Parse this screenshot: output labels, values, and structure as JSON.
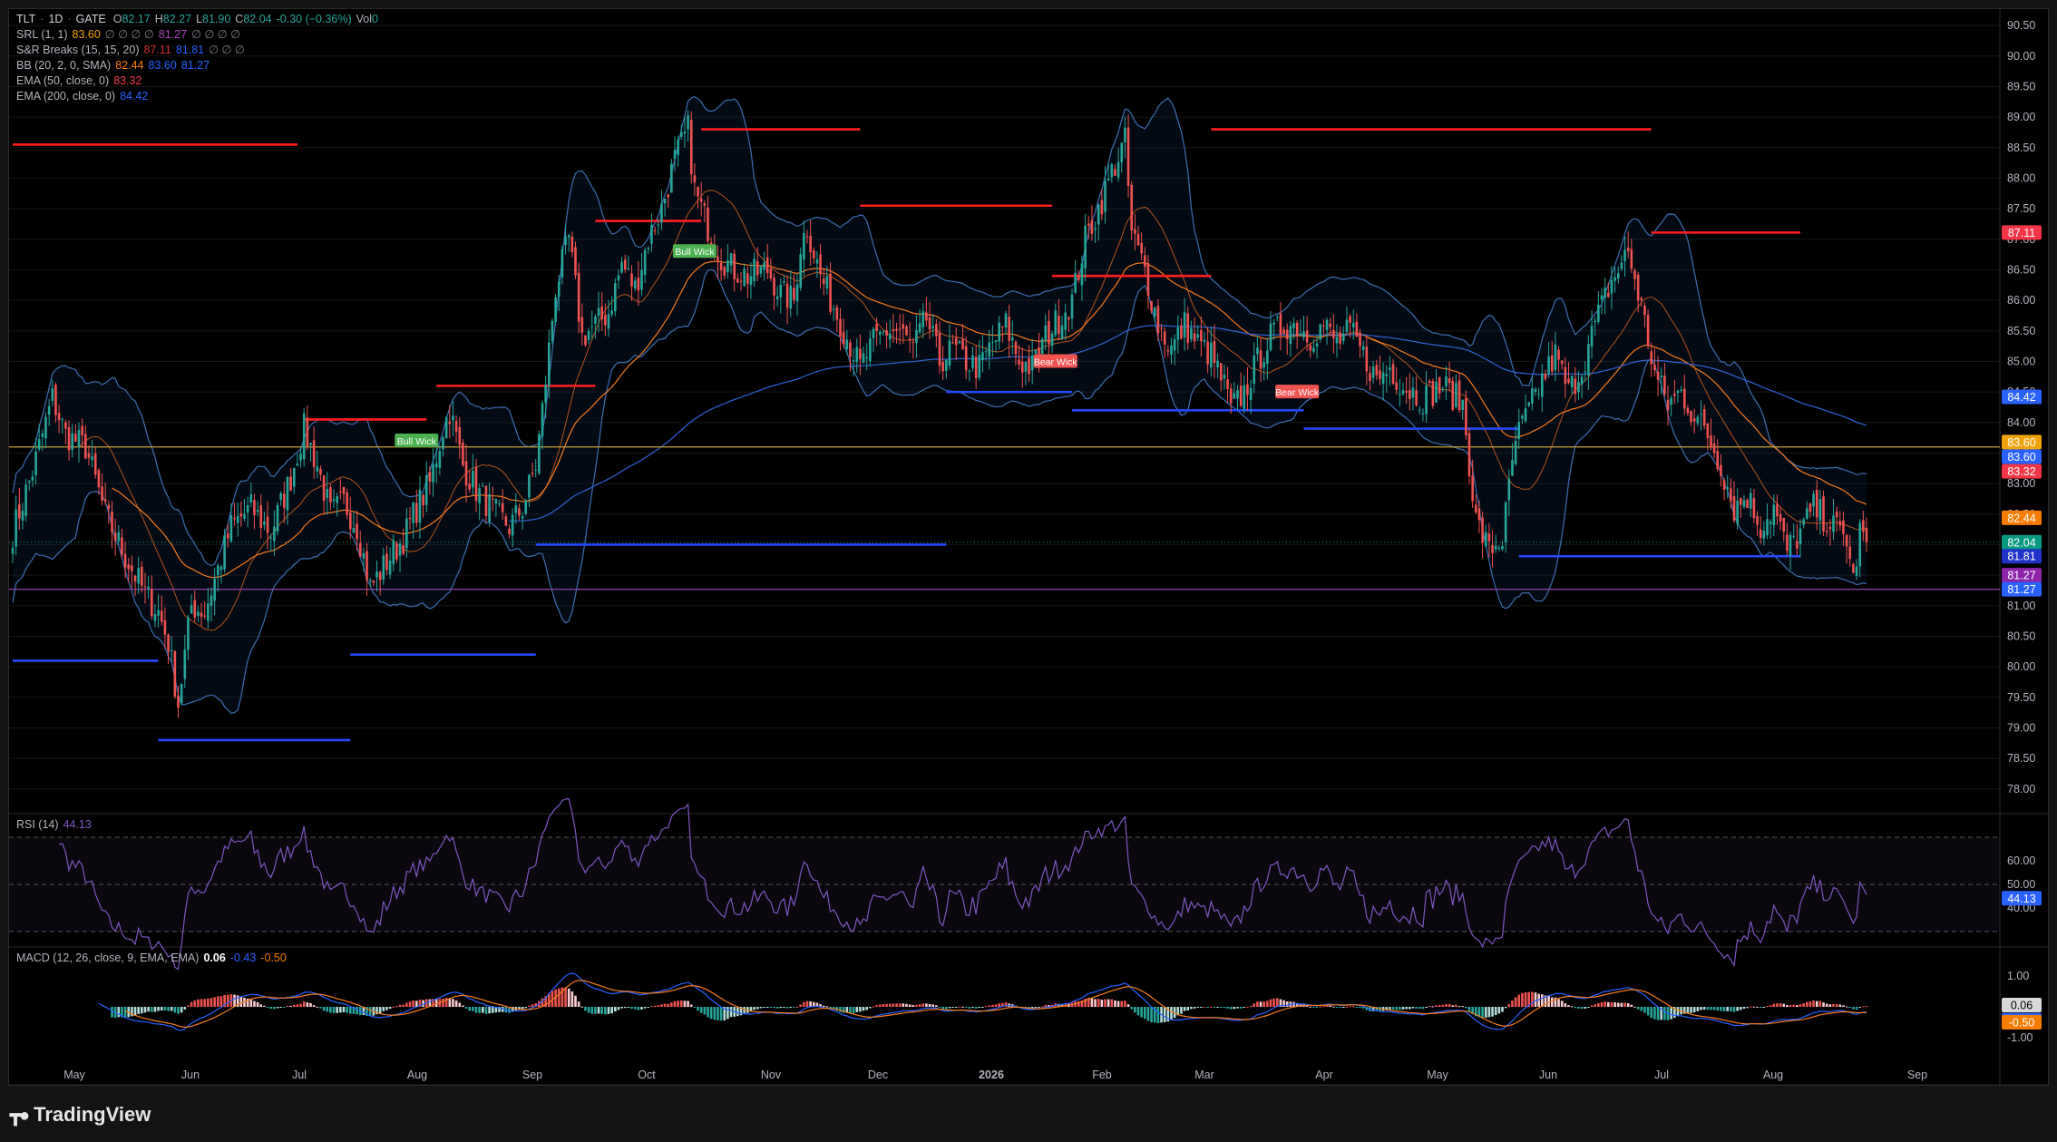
{
  "brand": {
    "name": "TradingView"
  },
  "colors": {
    "up": "#26a69a",
    "down": "#ef5350",
    "res": "#ff1e1e",
    "sup": "#2548ff",
    "bb": "#3d6db3",
    "ema50": "#f57c1f",
    "ema200": "#2f63d6",
    "srl": "#c8a035",
    "rsi": "#7e57c2",
    "srl2": "#8e44ad"
  },
  "legend": {
    "main": {
      "symbol": "TLT",
      "interval": "1D",
      "exchange": "GATE",
      "o_label": "O",
      "o": "82.17",
      "h_label": "H",
      "h": "82.27",
      "l_label": "L",
      "l": "81.90",
      "c_label": "C",
      "c": "82.04",
      "chg": "-0.30 (−0.36%)",
      "vol_label": "Vol",
      "vol": "0"
    },
    "srl": {
      "name": "SRL (1, 1)",
      "v1": "83.60",
      "dots": "∅ ∅ ∅ ∅",
      "v2": "81.27",
      "dots2": "∅ ∅ ∅ ∅"
    },
    "sr": {
      "name": "S&R Breaks (15, 15, 20)",
      "v1": "87.11",
      "v2": "81.81",
      "dots": "∅ ∅ ∅"
    },
    "bb": {
      "name": "BB (20, 2, 0, SMA)",
      "v1": "82.44",
      "v2": "83.60",
      "v3": "81.27"
    },
    "ema50": {
      "name": "EMA (50, close, 0)",
      "v": "83.32"
    },
    "ema200": {
      "name": "EMA (200, close, 0)",
      "v": "84.42"
    },
    "rsi": {
      "name": "RSI (14)",
      "v": "44.13"
    },
    "macd": {
      "name": "MACD (12, 26, close, 9, EMA, EMA)",
      "v1": "0.06",
      "v2": "-0.43",
      "v3": "-0.50"
    }
  },
  "chart_data": [
    {
      "type": "candlestick",
      "title": "TLT · 1D · GATE",
      "x_ticks": [
        "May",
        "Jun",
        "Jul",
        "Aug",
        "Sep",
        "Oct",
        "Nov",
        "Dec",
        "2026",
        "Feb",
        "Mar",
        "Apr",
        "May",
        "Jun",
        "Jul",
        "Aug",
        "Sep"
      ],
      "y_ticks": [
        "78.00",
        "78.50",
        "79.00",
        "79.50",
        "80.00",
        "80.50",
        "81.00",
        "81.50",
        "82.00",
        "82.50",
        "83.00",
        "83.50",
        "84.00",
        "84.50",
        "85.00",
        "85.50",
        "86.00",
        "86.50",
        "87.00",
        "87.50",
        "88.00",
        "88.50",
        "89.00",
        "89.50",
        "90.00",
        "90.50"
      ],
      "ylim": [
        77.7,
        90.65
      ],
      "series_close_path": [
        [
          0,
          82.2
        ],
        [
          6,
          83.2
        ],
        [
          12,
          84.4
        ],
        [
          16,
          83.8
        ],
        [
          22,
          83.6
        ],
        [
          28,
          82.5
        ],
        [
          34,
          81.8
        ],
        [
          40,
          81.2
        ],
        [
          44,
          80.9
        ],
        [
          47,
          80.4
        ],
        [
          50,
          79.4
        ],
        [
          54,
          81.0
        ],
        [
          58,
          80.9
        ],
        [
          62,
          81.6
        ],
        [
          66,
          82.3
        ],
        [
          72,
          82.6
        ],
        [
          78,
          82.2
        ],
        [
          84,
          83.1
        ],
        [
          88,
          83.9
        ],
        [
          92,
          83.3
        ],
        [
          96,
          82.5
        ],
        [
          100,
          82.7
        ],
        [
          104,
          82.3
        ],
        [
          108,
          81.3
        ],
        [
          114,
          81.8
        ],
        [
          118,
          82.1
        ],
        [
          122,
          82.6
        ],
        [
          126,
          83.0
        ],
        [
          130,
          83.9
        ],
        [
          132,
          84.2
        ],
        [
          136,
          83.3
        ],
        [
          140,
          82.9
        ],
        [
          146,
          82.5
        ],
        [
          150,
          82.3
        ],
        [
          154,
          82.6
        ],
        [
          158,
          83.3
        ],
        [
          160,
          84.2
        ],
        [
          164,
          86.2
        ],
        [
          168,
          87.0
        ],
        [
          172,
          85.4
        ],
        [
          176,
          85.6
        ],
        [
          180,
          85.8
        ],
        [
          184,
          86.6
        ],
        [
          188,
          86.2
        ],
        [
          192,
          87.0
        ],
        [
          196,
          87.5
        ],
        [
          200,
          88.3
        ],
        [
          204,
          88.8
        ],
        [
          206,
          87.8
        ],
        [
          210,
          87.2
        ],
        [
          214,
          86.7
        ],
        [
          218,
          86.5
        ],
        [
          222,
          86.4
        ],
        [
          228,
          86.5
        ],
        [
          232,
          86.1
        ],
        [
          236,
          86.0
        ],
        [
          238,
          86.9
        ],
        [
          240,
          87.2
        ],
        [
          244,
          86.4
        ],
        [
          248,
          85.9
        ],
        [
          252,
          85.4
        ],
        [
          256,
          84.9
        ],
        [
          260,
          85.3
        ],
        [
          264,
          85.5
        ],
        [
          268,
          85.5
        ],
        [
          272,
          85.2
        ],
        [
          276,
          85.7
        ],
        [
          280,
          85.0
        ],
        [
          284,
          85.2
        ],
        [
          288,
          85.0
        ],
        [
          292,
          84.9
        ],
        [
          296,
          85.3
        ],
        [
          300,
          85.6
        ],
        [
          304,
          85.0
        ],
        [
          308,
          84.9
        ],
        [
          312,
          85.4
        ],
        [
          316,
          85.7
        ],
        [
          320,
          86.0
        ],
        [
          324,
          87.0
        ],
        [
          328,
          87.5
        ],
        [
          332,
          88.1
        ],
        [
          336,
          88.6
        ],
        [
          338,
          87.1
        ],
        [
          342,
          86.5
        ],
        [
          346,
          85.6
        ],
        [
          350,
          85.2
        ],
        [
          354,
          85.6
        ],
        [
          358,
          85.3
        ],
        [
          362,
          85.1
        ],
        [
          366,
          84.6
        ],
        [
          368,
          84.2
        ],
        [
          372,
          84.5
        ],
        [
          376,
          85.0
        ],
        [
          380,
          85.4
        ],
        [
          384,
          85.6
        ],
        [
          388,
          85.6
        ],
        [
          392,
          85.4
        ],
        [
          396,
          85.6
        ],
        [
          400,
          85.3
        ],
        [
          404,
          85.5
        ],
        [
          408,
          85.1
        ],
        [
          412,
          84.7
        ],
        [
          416,
          84.9
        ],
        [
          420,
          84.6
        ],
        [
          426,
          84.4
        ],
        [
          432,
          84.6
        ],
        [
          438,
          84.3
        ],
        [
          442,
          82.4
        ],
        [
          446,
          81.9
        ],
        [
          450,
          82.1
        ],
        [
          454,
          83.7
        ],
        [
          458,
          84.2
        ],
        [
          462,
          84.7
        ],
        [
          466,
          85.1
        ],
        [
          470,
          84.5
        ],
        [
          474,
          84.9
        ],
        [
          478,
          85.6
        ],
        [
          482,
          86.2
        ],
        [
          486,
          86.6
        ],
        [
          488,
          86.8
        ],
        [
          492,
          85.9
        ],
        [
          496,
          84.8
        ],
        [
          500,
          84.3
        ],
        [
          504,
          84.5
        ],
        [
          508,
          84.1
        ],
        [
          512,
          83.8
        ],
        [
          516,
          83.3
        ],
        [
          520,
          82.6
        ],
        [
          524,
          82.8
        ],
        [
          528,
          82.3
        ],
        [
          532,
          82.6
        ],
        [
          536,
          81.9
        ],
        [
          540,
          82.2
        ],
        [
          544,
          82.6
        ],
        [
          548,
          82.4
        ],
        [
          552,
          82.2
        ],
        [
          554,
          82.1
        ],
        [
          556,
          81.4
        ],
        [
          558,
          82.2
        ],
        [
          560,
          82.04
        ]
      ]
    },
    {
      "type": "line",
      "title": "RSI (14)",
      "y_ticks": [
        "40.00",
        "50.00",
        "60.00"
      ],
      "last": 44.13,
      "bands": [
        30,
        50,
        70
      ]
    },
    {
      "type": "bar",
      "title": "MACD (12, 26, close, 9, EMA, EMA)",
      "y_ticks": [
        "-1.00",
        "0.00",
        "1.00"
      ],
      "histogram_last": 0.06,
      "macd_last": -0.43,
      "signal_last": -0.5
    }
  ],
  "levels": {
    "res": [
      [
        0,
        88.55,
        86
      ],
      [
        88,
        84.05,
        125
      ],
      [
        128,
        84.6,
        176
      ],
      [
        176,
        87.3,
        208
      ],
      [
        208,
        88.8,
        256
      ],
      [
        256,
        87.55,
        314
      ],
      [
        314,
        86.4,
        362
      ],
      [
        362,
        88.8,
        495
      ],
      [
        495,
        87.11,
        540
      ]
    ],
    "sup": [
      [
        0,
        80.1,
        44
      ],
      [
        44,
        78.8,
        102
      ],
      [
        102,
        80.2,
        158
      ],
      [
        158,
        82.0,
        282
      ],
      [
        282,
        84.5,
        320
      ],
      [
        320,
        84.2,
        390
      ],
      [
        390,
        83.9,
        455
      ],
      [
        455,
        81.81,
        540
      ]
    ],
    "srl_upper": 83.6,
    "srl_lower": 81.27,
    "last_close": 82.04
  },
  "annotations": [
    {
      "text": "Bull Wick",
      "bar": 122,
      "price": 83.7,
      "kind": "bull"
    },
    {
      "text": "Bull Wick",
      "bar": 206,
      "price": 86.8,
      "kind": "bull"
    },
    {
      "text": "Bear Wick",
      "bar": 315,
      "price": 85.0,
      "kind": "bear"
    },
    {
      "text": "Bear Wick",
      "bar": 388,
      "price": 84.5,
      "kind": "bear"
    }
  ],
  "price_tags": [
    {
      "text": "87.11",
      "price": 87.11,
      "color": "#f23645"
    },
    {
      "text": "84.42",
      "price": 84.42,
      "color": "#2962ff"
    },
    {
      "text": "83.60",
      "price": 83.68,
      "color": "#f0a30a"
    },
    {
      "text": "83.60",
      "price": 83.44,
      "color": "#2962ff"
    },
    {
      "text": "83.32",
      "price": 83.2,
      "color": "#f23645"
    },
    {
      "text": "82.44",
      "price": 82.44,
      "color": "#f57c00"
    },
    {
      "text": "82.04",
      "price": 82.04,
      "color": "#089981"
    },
    {
      "text": "81.81",
      "price": 81.81,
      "color": "#2033c9"
    },
    {
      "text": "81.27",
      "price": 81.5,
      "color": "#8e24aa"
    },
    {
      "text": "81.27",
      "price": 81.27,
      "color": "#2962ff"
    }
  ],
  "indicator_tags": {
    "rsi": {
      "text": "44.13",
      "color": "#2962ff"
    },
    "macd": [
      {
        "text": "0.06",
        "color": "#d8d8d8",
        "dark": true
      },
      {
        "text": "-0.43",
        "color": "#2962ff"
      },
      {
        "text": "-0.50",
        "color": "#f57c00"
      }
    ]
  }
}
